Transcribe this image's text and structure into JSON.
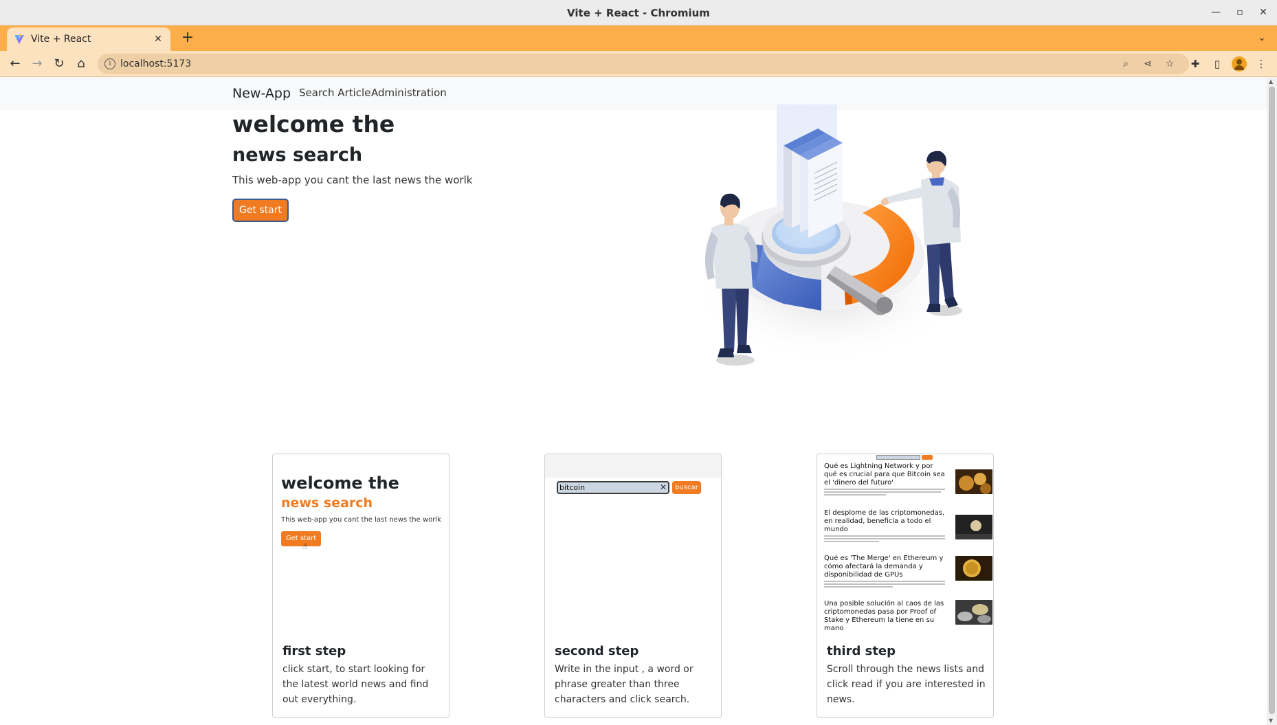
{
  "window": {
    "title": "Vite + React - Chromium"
  },
  "tab": {
    "title": "Vite + React"
  },
  "address_bar": {
    "url": "localhost:5173"
  },
  "navbar": {
    "brand": "New-App",
    "links": [
      "Search Article",
      "Administration"
    ]
  },
  "hero": {
    "title_line1": "welcome the",
    "title_line2": "news search",
    "description": "This web-app you cant the last news the worlk",
    "button_label": "Get start"
  },
  "cards": [
    {
      "title": "first step",
      "text": "click start, to start looking for the latest world news and find out everything.",
      "mock": {
        "title_line1": "welcome the",
        "title_line2": "news search",
        "description": "This web-app you cant the last news the worlk",
        "button_label": "Get start"
      }
    },
    {
      "title": "second step",
      "text": "Write in the input , a word or phrase greater than three characters and click search.",
      "mock": {
        "input_value": "bitcoin",
        "button_label": "buscar"
      }
    },
    {
      "title": "third step",
      "text": "Scroll through the news lists and click read if you are interested in news.",
      "mock": {
        "news": [
          {
            "title": "Qué es Lightning Network y por qué es crucial para que Bitcoin sea el 'dinero del futuro'"
          },
          {
            "title": "El desplome de las criptomonedas, en realidad, beneficia a todo el mundo"
          },
          {
            "title": "Qué es 'The Merge' en Ethereum y cómo afectará la demanda y disponibilidad de GPUs"
          },
          {
            "title": "Una posible solución al caos de las criptomonedas pasa por Proof of Stake y Ethereum la tiene en su mano"
          }
        ]
      }
    }
  ],
  "colors": {
    "accent": "#f07b21",
    "tabstrip": "#fbae4a",
    "toolbar": "#fde2bf",
    "navbar_bg": "#f8f9fa"
  }
}
